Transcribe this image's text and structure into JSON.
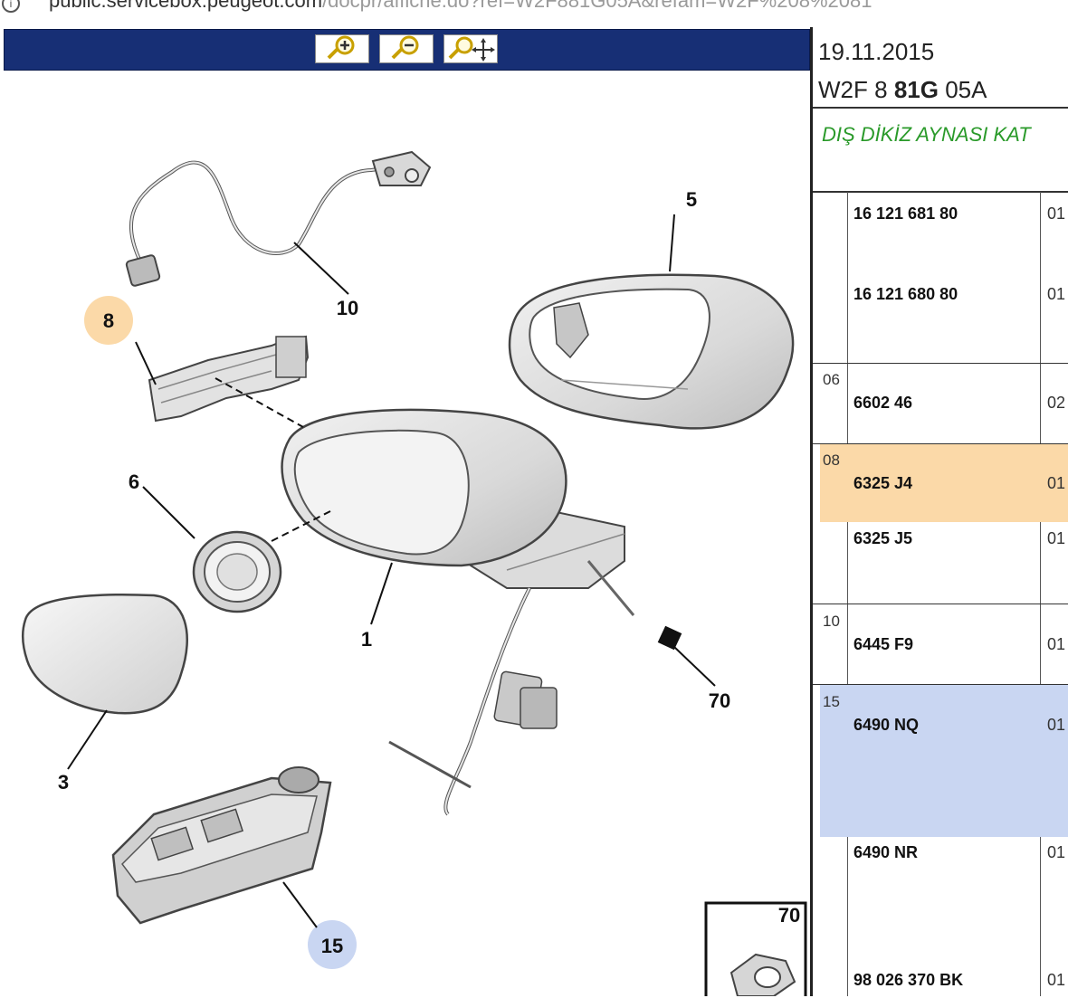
{
  "browser": {
    "url_host": "public.servicebox.peugeot.com",
    "url_rest": "/docpr/affiche.do?ref=W2F881G05A&refam=W2F%208%2081"
  },
  "toolbar": {
    "buttons": [
      {
        "name": "zoom-in",
        "icon": "magnifier-plus-icon"
      },
      {
        "name": "zoom-out",
        "icon": "magnifier-minus-icon"
      },
      {
        "name": "pan",
        "icon": "magnifier-move-icon"
      }
    ]
  },
  "diagram": {
    "labels": {
      "l1": "1",
      "l3": "3",
      "l5": "5",
      "l6": "6",
      "l8": "8",
      "l10": "10",
      "l15": "15",
      "l70": "70",
      "inset": "70"
    },
    "highlight_orange": "#fbd9a8",
    "highlight_blue": "#c9d6f2"
  },
  "panel": {
    "date": "19.11.2015",
    "code_a": "W2F 8",
    "code_b": "81G",
    "code_c": "05A",
    "title": "DIŞ DİKİZ AYNASI KAT",
    "rows": [
      {
        "ref": "",
        "part": "16 121 681 80",
        "qty": "01"
      },
      {
        "ref": "",
        "part": "16 121 680 80",
        "qty": "01"
      },
      {
        "ref": "06",
        "part": "6602 46",
        "qty": "02"
      },
      {
        "ref": "08",
        "part": "6325 J4",
        "qty": "01"
      },
      {
        "ref": "",
        "part": "6325 J5",
        "qty": "01"
      },
      {
        "ref": "10",
        "part": "6445 F9",
        "qty": "01"
      },
      {
        "ref": "15",
        "part": "6490 NQ",
        "qty": "01"
      },
      {
        "ref": "",
        "part": "6490 NR",
        "qty": "01"
      },
      {
        "ref": "",
        "part": "98 026 370 BK",
        "qty": "01"
      }
    ]
  }
}
